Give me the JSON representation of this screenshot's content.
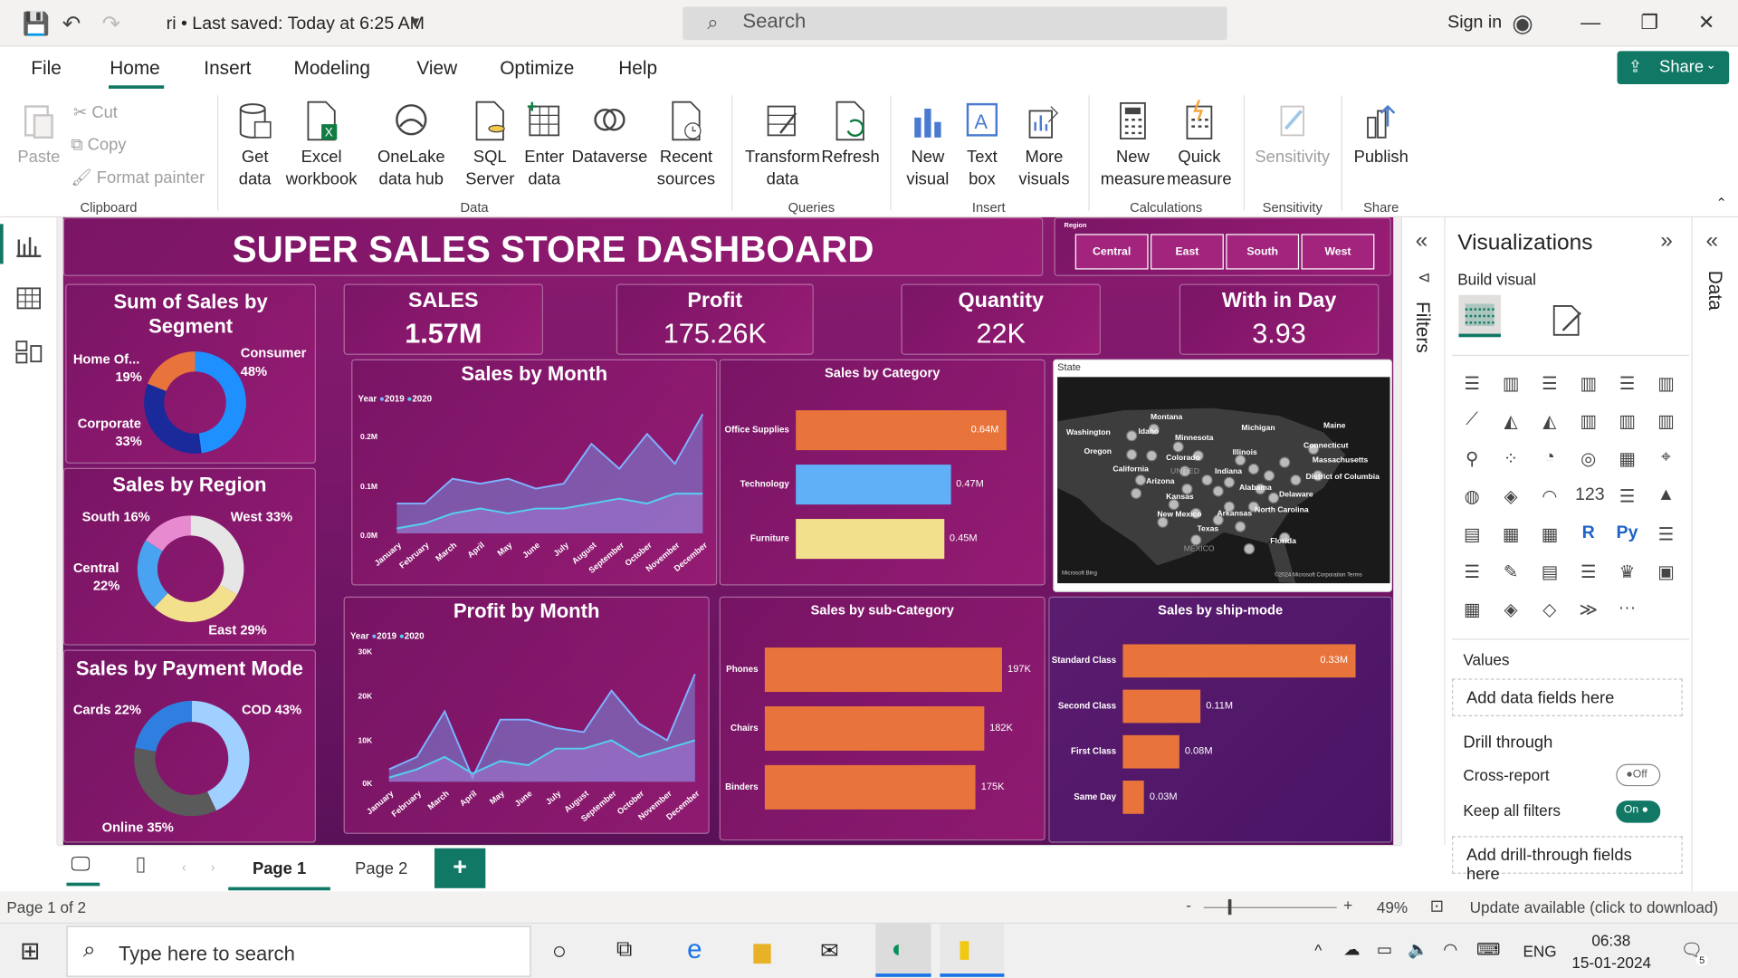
{
  "titlebar": {
    "doc_title": "ri • Last saved: Today at 6:25 AM",
    "search_placeholder": "Search",
    "signin": "Sign in"
  },
  "menu": {
    "items": [
      "File",
      "Home",
      "Insert",
      "Modeling",
      "View",
      "Optimize",
      "Help"
    ],
    "share": "Share"
  },
  "ribbon": {
    "clipboard": {
      "paste": "Paste",
      "cut": "Cut",
      "copy": "Copy",
      "format_painter": "Format painter",
      "group": "Clipboard"
    },
    "data": {
      "get_data": "Get data",
      "excel": "Excel workbook",
      "onelake": "OneLake data hub",
      "sql": "SQL Server",
      "enter": "Enter data",
      "dataverse": "Dataverse",
      "recent": "Recent sources",
      "group": "Data"
    },
    "queries": {
      "transform": "Transform data",
      "refresh": "Refresh",
      "group": "Queries"
    },
    "insert": {
      "new_visual": "New visual",
      "text_box": "Text box",
      "more_visuals": "More visuals",
      "group": "Insert"
    },
    "calculations": {
      "new_measure": "New measure",
      "quick_measure": "Quick measure",
      "group": "Calculations"
    },
    "sensitivity": {
      "label": "Sensitivity",
      "group": "Sensitivity"
    },
    "share": {
      "publish": "Publish",
      "group": "Share"
    }
  },
  "report": {
    "title": "SUPER SALES STORE DASHBOARD",
    "region_slicer": {
      "title": "Region",
      "options": [
        "Central",
        "East",
        "South",
        "West"
      ]
    },
    "kpis": [
      {
        "title": "SALES",
        "value": "1.57M"
      },
      {
        "title": "Profit",
        "value": "175.26K"
      },
      {
        "title": "Quantity",
        "value": "22K"
      },
      {
        "title": "With in Day",
        "value": "3.93"
      }
    ],
    "segment": {
      "title": "Sum of Sales by Segment",
      "labels": [
        "Home Of...",
        "19%",
        "Consumer",
        "48%",
        "Corporate",
        "33%"
      ]
    },
    "region": {
      "title": "Sales by Region",
      "labels": [
        "South 16%",
        "West 33%",
        "Central",
        "22%",
        "East 29%"
      ]
    },
    "payment": {
      "title": "Sales by Payment Mode",
      "labels": [
        "Cards 22%",
        "COD 43%",
        "Online 35%"
      ]
    },
    "sales_month": {
      "title": "Sales by Month",
      "legend": {
        "title": "Year",
        "s1": "2019",
        "s2": "2020"
      },
      "yticks": [
        "0.2M",
        "0.1M",
        "0.0M"
      ]
    },
    "profit_month": {
      "title": "Profit by Month",
      "legend": {
        "title": "Year",
        "s1": "2019",
        "s2": "2020"
      },
      "yticks": [
        "30K",
        "20K",
        "10K",
        "0K"
      ]
    },
    "months": [
      "January",
      "February",
      "March",
      "April",
      "May",
      "June",
      "July",
      "August",
      "September",
      "October",
      "November",
      "December"
    ],
    "category": {
      "title": "Sales by Category"
    },
    "subcategory": {
      "title": "Sales by sub-Category"
    },
    "shipmode": {
      "title": "Sales by ship-mode"
    },
    "map": {
      "title": "State",
      "credit": "©2024 Microsoft Corporation  Terms",
      "bing": "Microsoft Bing",
      "cities": [
        "Montana",
        "Washington",
        "Idaho",
        "Minnesota",
        "Michigan",
        "Maine",
        "Oregon",
        "Connecticut",
        "Colorado",
        "Illinois",
        "Massachusetts",
        "California",
        "UNITED",
        "Indiana",
        "District of Columbia",
        "Arizona",
        "Alabama",
        "Delaware",
        "Kansas",
        "New Mexico",
        "Arkansas",
        "North Carolina",
        "Texas",
        "MEXICO",
        "Florida"
      ]
    }
  },
  "chart_data": [
    {
      "type": "pie",
      "title": "Sum of Sales by Segment",
      "categories": [
        "Consumer",
        "Corporate",
        "Home Of..."
      ],
      "values": [
        48,
        33,
        19
      ],
      "unit": "%"
    },
    {
      "type": "pie",
      "title": "Sales by Region",
      "categories": [
        "West",
        "East",
        "Central",
        "South"
      ],
      "values": [
        33,
        29,
        22,
        16
      ],
      "unit": "%"
    },
    {
      "type": "pie",
      "title": "Sales by Payment Mode",
      "categories": [
        "COD",
        "Online",
        "Cards"
      ],
      "values": [
        43,
        35,
        22
      ],
      "unit": "%"
    },
    {
      "type": "area",
      "title": "Sales by Month",
      "categories": [
        "January",
        "February",
        "March",
        "April",
        "May",
        "June",
        "July",
        "August",
        "September",
        "October",
        "November",
        "December"
      ],
      "series": [
        {
          "name": "2019",
          "values": [
            0.06,
            0.06,
            0.11,
            0.1,
            0.11,
            0.09,
            0.1,
            0.18,
            0.13,
            0.2,
            0.14,
            0.24
          ]
        },
        {
          "name": "2020",
          "values": [
            0.01,
            0.02,
            0.04,
            0.05,
            0.04,
            0.05,
            0.05,
            0.06,
            0.07,
            0.06,
            0.08,
            0.08
          ]
        }
      ],
      "ylabel": "",
      "ylim": [
        0,
        0.25
      ]
    },
    {
      "type": "area",
      "title": "Profit by Month",
      "categories": [
        "January",
        "February",
        "March",
        "April",
        "May",
        "June",
        "July",
        "August",
        "September",
        "October",
        "November",
        "December"
      ],
      "series": [
        {
          "name": "2019",
          "values": [
            3000,
            6000,
            17000,
            1000,
            15000,
            15000,
            13000,
            12000,
            22000,
            14000,
            10000,
            26000
          ]
        },
        {
          "name": "2020",
          "values": [
            1000,
            3000,
            6000,
            2000,
            5000,
            4000,
            8000,
            8000,
            10000,
            6000,
            8000,
            10000
          ]
        }
      ],
      "ylabel": "",
      "ylim": [
        0,
        30000
      ]
    },
    {
      "type": "bar",
      "title": "Sales by Category",
      "categories": [
        "Office Supplies",
        "Technology",
        "Furniture"
      ],
      "values": [
        0.64,
        0.47,
        0.45
      ],
      "labels": [
        "0.64M",
        "0.47M",
        "0.45M"
      ],
      "colors": [
        "#e8743b",
        "#5fb0f7",
        "#f3e08c"
      ]
    },
    {
      "type": "bar",
      "title": "Sales by sub-Category",
      "categories": [
        "Phones",
        "Chairs",
        "Binders"
      ],
      "values": [
        197,
        182,
        175
      ],
      "labels": [
        "197K",
        "182K",
        "175K"
      ]
    },
    {
      "type": "bar",
      "title": "Sales by ship-mode",
      "categories": [
        "Standard Class",
        "Second Class",
        "First Class",
        "Same Day"
      ],
      "values": [
        0.33,
        0.11,
        0.08,
        0.03
      ],
      "labels": [
        "0.33M",
        "0.11M",
        "0.08M",
        "0.03M"
      ]
    }
  ],
  "viz_pane": {
    "title": "Visualizations",
    "build": "Build visual",
    "values": "Values",
    "values_ph": "Add data fields here",
    "drill": "Drill through",
    "cross": "Cross-report",
    "cross_state": "Off",
    "keep": "Keep all filters",
    "keep_state": "On",
    "drill_ph": "Add drill-through fields here"
  },
  "filters_label": "Filters",
  "data_label": "Data",
  "tabs": {
    "page1": "Page 1",
    "page2": "Page 2",
    "add": "+"
  },
  "status": {
    "page": "Page 1 of 2",
    "zoom": "49%",
    "update": "Update available (click to download)"
  },
  "taskbar": {
    "search": "Type here to search",
    "lang": "ENG",
    "time": "06:38",
    "date": "15-01-2024",
    "notif": "5"
  },
  "colors": {
    "accent": "#117865",
    "report_bg": "#8a1b6e",
    "bar_orange": "#e8743b"
  }
}
